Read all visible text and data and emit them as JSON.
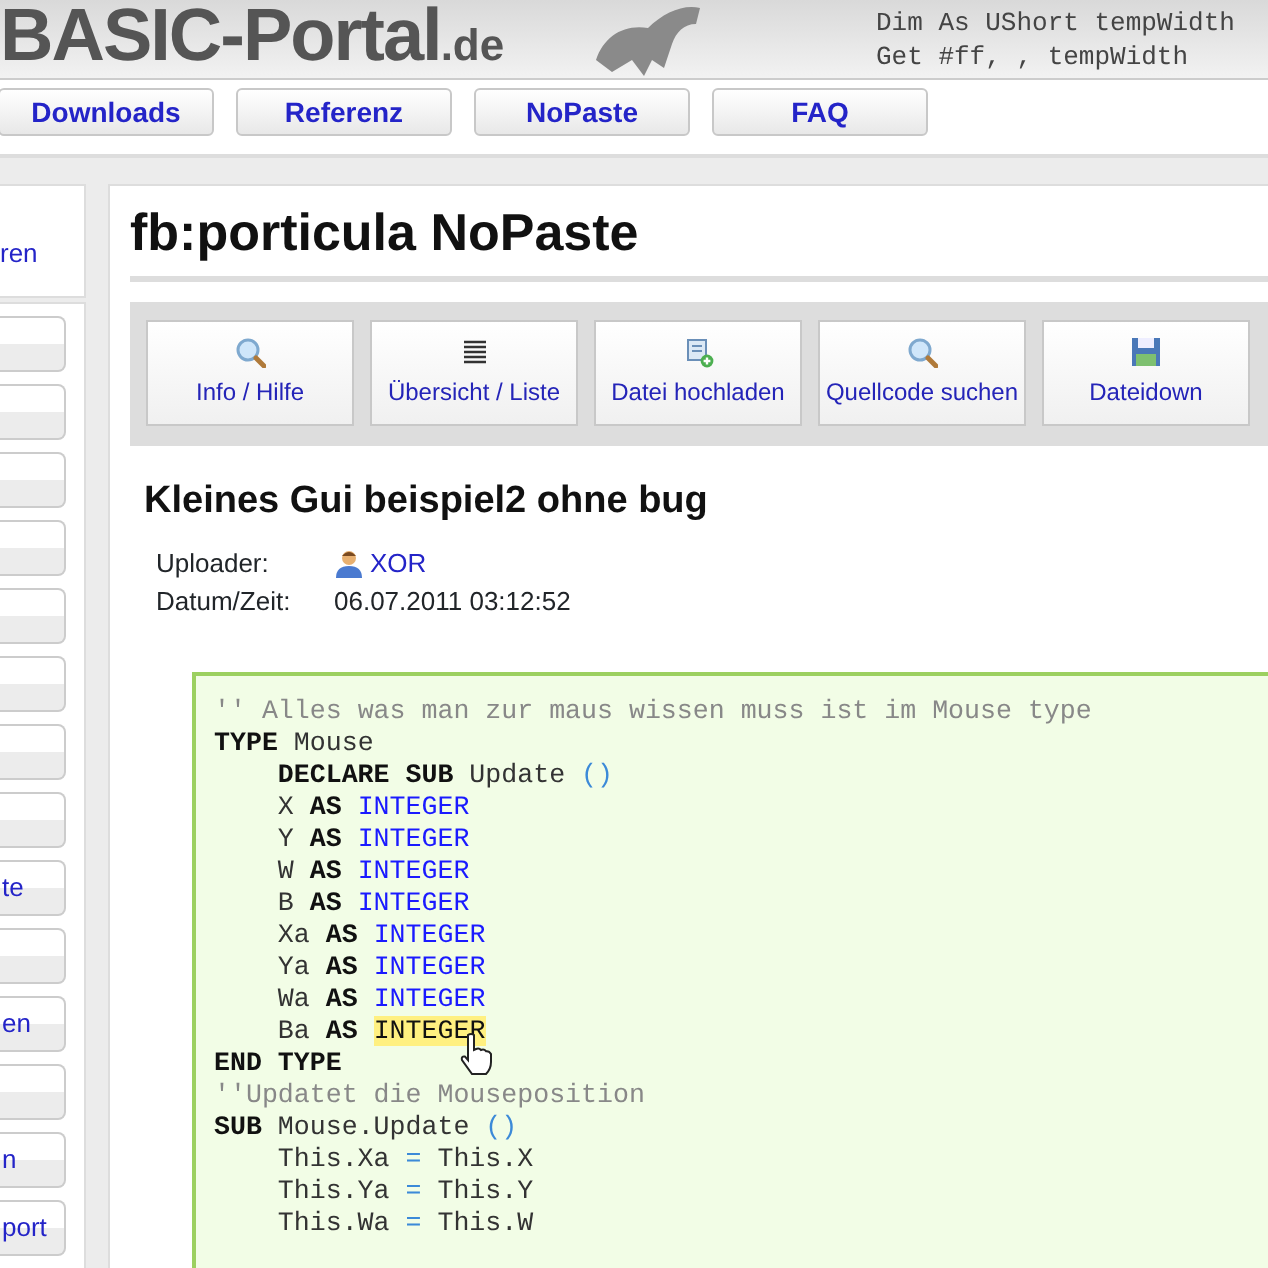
{
  "banner": {
    "logo": "BASIC-Portal",
    "logo_suffix": ".de",
    "code_lines": [
      "Dim As UShort tempWidth",
      "Get #ff, , tempWidth"
    ]
  },
  "nav": [
    "Downloads",
    "Referenz",
    "NoPaste",
    "FAQ"
  ],
  "sidebar": {
    "link": "ren",
    "items": [
      {
        "kind": "blank"
      },
      {
        "kind": "blank"
      },
      {
        "kind": "blank"
      },
      {
        "kind": "blank"
      },
      {
        "kind": "blank"
      },
      {
        "kind": "blank"
      },
      {
        "kind": "blank"
      },
      {
        "kind": "blank"
      },
      {
        "kind": "text",
        "label": "te"
      },
      {
        "kind": "blank"
      },
      {
        "kind": "text",
        "label": "en"
      },
      {
        "kind": "blank"
      },
      {
        "kind": "text",
        "label": "n"
      },
      {
        "kind": "text",
        "label": "port"
      }
    ]
  },
  "page_title": "fb:porticula NoPaste",
  "toolbar": [
    {
      "kind": "search",
      "label": "Info / Hilfe"
    },
    {
      "kind": "list",
      "label": "Übersicht / Liste"
    },
    {
      "kind": "upload",
      "label": "Datei hochladen"
    },
    {
      "kind": "search",
      "label": "Quellcode suchen"
    },
    {
      "kind": "save",
      "label": "Dateidown"
    }
  ],
  "entry": {
    "title": "Kleines Gui beispiel2 ohne bug",
    "meta": [
      {
        "kind": "user",
        "label": "Uploader:",
        "value": "XOR"
      },
      {
        "kind": "text",
        "label": "Datum/Zeit:",
        "value": "06.07.2011 03:12:52"
      }
    ]
  },
  "code": [
    {
      "indented": false,
      "tokens": [
        {
          "kind": "comment",
          "text": "'' Alles was man zur maus wissen muss ist im Mouse type",
          "highlighted": false
        }
      ]
    },
    {
      "indented": false,
      "tokens": [
        {
          "kind": "keyword",
          "text": "TYPE",
          "highlighted": false
        },
        {
          "kind": "plain",
          "text": " Mouse",
          "highlighted": false
        }
      ]
    },
    {
      "indented": true,
      "tokens": [
        {
          "kind": "keyword",
          "text": "DECLARE SUB",
          "highlighted": false
        },
        {
          "kind": "plain",
          "text": " Update ",
          "highlighted": false
        },
        {
          "kind": "op",
          "text": "()",
          "highlighted": false
        }
      ]
    },
    {
      "indented": true,
      "tokens": [
        {
          "kind": "plain",
          "text": "X ",
          "highlighted": false
        },
        {
          "kind": "keyword",
          "text": "AS ",
          "highlighted": false
        },
        {
          "kind": "type",
          "text": "INTEGER",
          "highlighted": false
        }
      ]
    },
    {
      "indented": true,
      "tokens": [
        {
          "kind": "plain",
          "text": "Y ",
          "highlighted": false
        },
        {
          "kind": "keyword",
          "text": "AS ",
          "highlighted": false
        },
        {
          "kind": "type",
          "text": "INTEGER",
          "highlighted": false
        }
      ]
    },
    {
      "indented": true,
      "tokens": [
        {
          "kind": "plain",
          "text": "W ",
          "highlighted": false
        },
        {
          "kind": "keyword",
          "text": "AS ",
          "highlighted": false
        },
        {
          "kind": "type",
          "text": "INTEGER",
          "highlighted": false
        }
      ]
    },
    {
      "indented": true,
      "tokens": [
        {
          "kind": "plain",
          "text": "B ",
          "highlighted": false
        },
        {
          "kind": "keyword",
          "text": "AS ",
          "highlighted": false
        },
        {
          "kind": "type",
          "text": "INTEGER",
          "highlighted": false
        }
      ]
    },
    {
      "indented": true,
      "tokens": [
        {
          "kind": "plain",
          "text": "Xa ",
          "highlighted": false
        },
        {
          "kind": "keyword",
          "text": "AS ",
          "highlighted": false
        },
        {
          "kind": "type",
          "text": "INTEGER",
          "highlighted": false
        }
      ]
    },
    {
      "indented": true,
      "tokens": [
        {
          "kind": "plain",
          "text": "Ya ",
          "highlighted": false
        },
        {
          "kind": "keyword",
          "text": "AS ",
          "highlighted": false
        },
        {
          "kind": "type",
          "text": "INTEGER",
          "highlighted": false
        }
      ]
    },
    {
      "indented": true,
      "tokens": [
        {
          "kind": "plain",
          "text": "Wa ",
          "highlighted": false
        },
        {
          "kind": "keyword",
          "text": "AS ",
          "highlighted": false
        },
        {
          "kind": "type",
          "text": "INTEGER",
          "highlighted": false
        }
      ]
    },
    {
      "indented": true,
      "tokens": [
        {
          "kind": "plain",
          "text": "Ba ",
          "highlighted": false
        },
        {
          "kind": "keyword",
          "text": "AS ",
          "highlighted": false
        },
        {
          "kind": "type",
          "text": "INTEGER",
          "highlighted": true
        }
      ]
    },
    {
      "indented": false,
      "tokens": [
        {
          "kind": "keyword",
          "text": "END TYPE",
          "highlighted": false
        }
      ]
    },
    {
      "indented": false,
      "tokens": [
        {
          "kind": "comment",
          "text": "''Updatet die Mouseposition",
          "highlighted": false
        }
      ]
    },
    {
      "indented": false,
      "tokens": [
        {
          "kind": "keyword",
          "text": "SUB",
          "highlighted": false
        },
        {
          "kind": "plain",
          "text": " Mouse.Update ",
          "highlighted": false
        },
        {
          "kind": "op",
          "text": "()",
          "highlighted": false
        }
      ]
    },
    {
      "indented": true,
      "tokens": [
        {
          "kind": "plain",
          "text": "This.Xa ",
          "highlighted": false
        },
        {
          "kind": "op",
          "text": "=",
          "highlighted": false
        },
        {
          "kind": "plain",
          "text": " This.X",
          "highlighted": false
        }
      ]
    },
    {
      "indented": true,
      "tokens": [
        {
          "kind": "plain",
          "text": "This.Ya ",
          "highlighted": false
        },
        {
          "kind": "op",
          "text": "=",
          "highlighted": false
        },
        {
          "kind": "plain",
          "text": " This.Y",
          "highlighted": false
        }
      ]
    },
    {
      "indented": true,
      "tokens": [
        {
          "kind": "plain",
          "text": "This.Wa ",
          "highlighted": false
        },
        {
          "kind": "op",
          "text": "=",
          "highlighted": false
        },
        {
          "kind": "plain",
          "text": " This.W",
          "highlighted": false
        }
      ]
    }
  ]
}
